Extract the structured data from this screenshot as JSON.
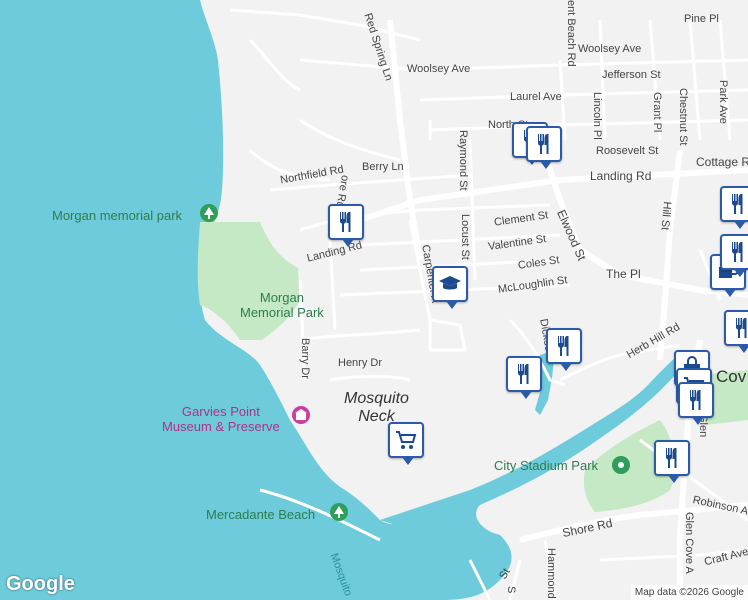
{
  "map": {
    "water_color": "#6ecbdb",
    "land_color": "#f2f2f2",
    "park_color": "#c5e8c5",
    "road_color": "#ffffff",
    "major_road_color": "#fde293",
    "pin_color": "#2a5aa8"
  },
  "streets": {
    "red_spring_ln": "Red Spring Ln",
    "woolsey_ave_1": "Woolsey Ave",
    "woolsey_ave_2": "Woolsey Ave",
    "pine_pl": "Pine Pl",
    "jefferson_st": "Jefferson St",
    "laurel_ave": "Laurel Ave",
    "north_st": "North St",
    "roosevelt_st": "Roosevelt St",
    "raymond_st": "Raymond St",
    "lincoln_pl": "Lincoln Pl",
    "grant_pl": "Grant Pl",
    "chestnut_st": "Chestnut St",
    "park_ave": "Park Ave",
    "crescent_beach_rd": "ent Beach Rd",
    "cottage_row": "Cottage R",
    "landing_rd_east": "Landing Rd",
    "landing_rd_west": "Landing Rd",
    "northfield_rd": "Northfield Rd",
    "berry_ln": "Berry Ln",
    "shore_dr_partial": "ore Rd",
    "clement_st": "Clement St",
    "valentine_st": "Valentine St",
    "coles_st": "Coles St",
    "mcloughlin_st": "McLoughlin St",
    "locust_st": "Locust St",
    "carpenter_ave": "Carpenter A",
    "elwood_st": "Elwood St",
    "the_pl": "The Pl",
    "dickson": "Dickso",
    "hill_st": "Hill St",
    "herb_hill_rd": "Herb Hill Rd",
    "henry_dr": "Henry Dr",
    "barry_dr": "Barry Dr",
    "glen_partial": "Glen",
    "robinson_ave": "Robinson Ave",
    "shore_rd": "Shore Rd",
    "hammond": "Hammond",
    "glen_cove_ave": "Glen Cove A",
    "craft_ave": "Craft Ave",
    "st_bottom": "St",
    "s_bottom": "S",
    "mosquito_creek": "Mosquito"
  },
  "places": {
    "mosquito_neck_line1": "Mosquito",
    "mosquito_neck_line2": "Neck",
    "glen_cove_partial": "Cov"
  },
  "pois": {
    "morgan_memorial_park_top": "Morgan memorial park",
    "morgan_memorial_park_line1": "Morgan",
    "morgan_memorial_park_line2": "Memorial Park",
    "garvies_line1": "Garvies Point",
    "garvies_line2": "Museum & Preserve",
    "city_stadium_park": "City Stadium Park",
    "mercadante_beach": "Mercadante Beach"
  },
  "markers": [
    {
      "type": "restaurant",
      "icon": "fork-knife-icon"
    },
    {
      "type": "restaurant",
      "icon": "fork-knife-icon"
    },
    {
      "type": "restaurant",
      "icon": "fork-knife-icon"
    },
    {
      "type": "school",
      "icon": "graduation-cap-icon"
    },
    {
      "type": "restaurant",
      "icon": "fork-knife-icon"
    },
    {
      "type": "restaurant",
      "icon": "fork-knife-icon"
    },
    {
      "type": "grocery",
      "icon": "shopping-cart-icon"
    },
    {
      "type": "restaurant",
      "icon": "fork-knife-icon"
    },
    {
      "type": "shopping",
      "icon": "shopping-bag-icon"
    },
    {
      "type": "grocery",
      "icon": "shopping-cart-icon"
    },
    {
      "type": "restaurant",
      "icon": "fork-knife-icon"
    },
    {
      "type": "restaurant",
      "icon": "fork-knife-icon"
    },
    {
      "type": "cafe",
      "icon": "coffee-cup-icon"
    },
    {
      "type": "restaurant",
      "icon": "fork-knife-icon"
    },
    {
      "type": "restaurant",
      "icon": "fork-knife-icon"
    }
  ],
  "attribution": {
    "logo": "Google",
    "credit": "Map data ©2026 Google"
  }
}
